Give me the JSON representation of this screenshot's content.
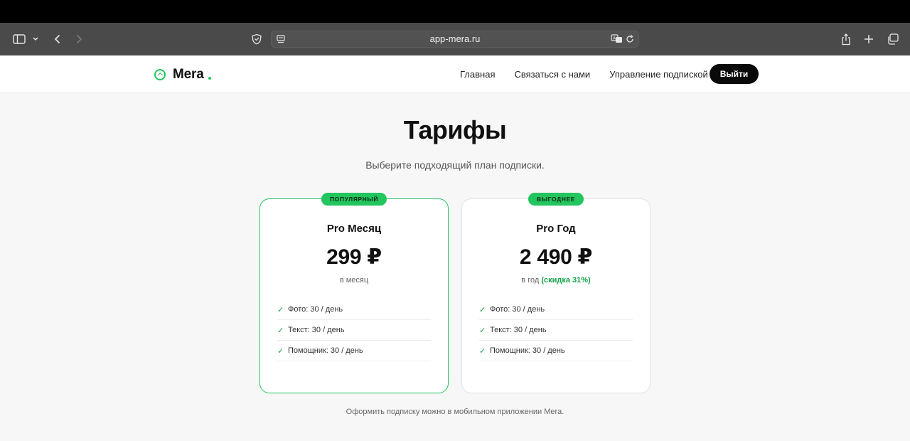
{
  "browser": {
    "url": "app-mera.ru",
    "icons": [
      "sidebar-icon",
      "chevron-down-icon",
      "back-arrow-icon",
      "forward-arrow-icon",
      "shield-icon",
      "reader-icon",
      "translate-icon",
      "reload-icon",
      "share-icon",
      "plus-icon",
      "tabs-icon"
    ]
  },
  "header": {
    "logo_text": "Mera",
    "nav": [
      "Главная",
      "Связаться с нами",
      "Управление подпиской"
    ],
    "logout_label": "Выйти"
  },
  "main": {
    "title": "Тарифы",
    "subtitle": "Выберите подходящий план подписки.",
    "plans": [
      {
        "badge": "ПОПУЛЯРНЫЙ",
        "name": "Pro Месяц",
        "price": "299 ₽",
        "period": "в месяц",
        "discount": "",
        "features": [
          "Фото: 30 / день",
          "Текст: 30 / день",
          "Помощник: 30 / день"
        ]
      },
      {
        "badge": "ВЫГОДНЕЕ",
        "name": "Pro Год",
        "price": "2 490 ₽",
        "period": "в год",
        "discount": "(скидка 31%)",
        "features": [
          "Фото: 30 / день",
          "Текст: 30 / день",
          "Помощник: 30 / день"
        ]
      }
    ],
    "footnote": "Оформить подписку можно в мобильном приложении Mera."
  },
  "colors": {
    "accent": "#22c55e",
    "accent_text": "#16a34a",
    "button_bg": "#0a0a0a",
    "toolbar_bg": "#4a4a4a"
  }
}
